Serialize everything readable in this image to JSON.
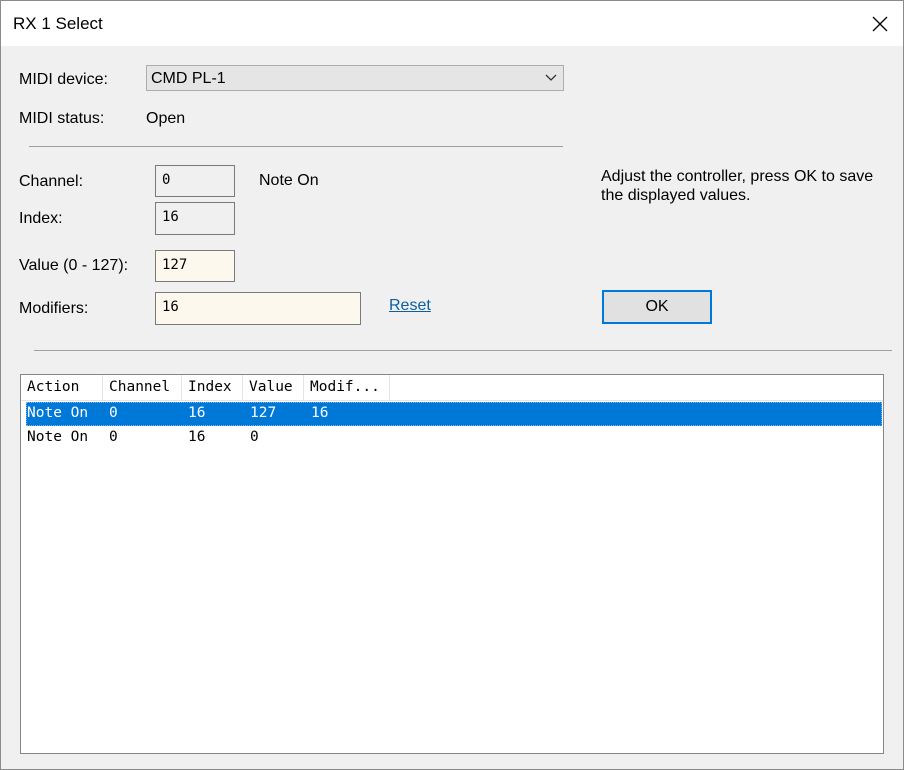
{
  "window": {
    "title": "RX 1 Select"
  },
  "midi": {
    "device_label": "MIDI device:",
    "device_value": "CMD PL-1",
    "status_label": "MIDI status:",
    "status_value": "Open"
  },
  "fields": {
    "channel_label": "Channel:",
    "channel_value": "0",
    "event_type": "Note On",
    "index_label": "Index:",
    "index_value": "16",
    "value_label": "Value (0 - 127):",
    "value_value": "127",
    "modifiers_label": "Modifiers:",
    "modifiers_value": "16",
    "reset_label": "Reset"
  },
  "hint": "Adjust the controller, press OK to save the displayed values.",
  "ok_label": "OK",
  "table": {
    "columns": [
      "Action",
      "Channel",
      "Index",
      "Value",
      "Modif..."
    ],
    "rows": [
      {
        "action": "Note On",
        "channel": "0",
        "index": "16",
        "value": "127",
        "modifiers": "16",
        "selected": true
      },
      {
        "action": "Note On",
        "channel": "0",
        "index": "16",
        "value": "0",
        "modifiers": "",
        "selected": false
      }
    ]
  },
  "colors": {
    "selection": "#0078d7",
    "link": "#0b5fa5",
    "focus_border": "#0078d7"
  }
}
